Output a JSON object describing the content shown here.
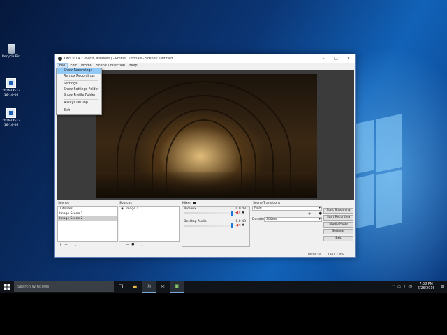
{
  "desktop": {
    "icons": [
      {
        "label": "Recycle Bin",
        "icon": "recycle-bin-icon"
      },
      {
        "label": "2016-06-17\n16-14-06",
        "icon": "image-file-icon"
      },
      {
        "label": "2016-06-17\n16-14-06",
        "icon": "image-file-icon"
      }
    ]
  },
  "obs": {
    "title": "OBS 0.14.2 (64bit, windows) - Profile: Tutorials - Scenes: Untitled",
    "menu": [
      "File",
      "Edit",
      "Profile",
      "Scene Collection",
      "Help"
    ],
    "active_menu": "File",
    "file_menu": {
      "items": [
        "Show Recordings",
        "Remux Recordings",
        "Settings",
        "Show Settings Folder",
        "Show Profile Folder",
        "Always On Top",
        "Exit"
      ],
      "highlighted": "Show Recordings"
    },
    "scenes": {
      "title": "Scenes",
      "items": [
        "Tutorials",
        "Image Scene 1",
        "Image Scene 2"
      ],
      "selected": "Image Scene 2"
    },
    "sources": {
      "title": "Sources",
      "items": [
        "Image 1"
      ]
    },
    "mixer": {
      "title": "Mixer",
      "channels": [
        {
          "name": "Mic/Aux",
          "db": "0.0 dB"
        },
        {
          "name": "Desktop Audio",
          "db": "0.0 dB"
        }
      ]
    },
    "transitions": {
      "title": "Scene Transitions",
      "selected": "Fade",
      "duration_label": "Duration",
      "duration_value": "300ms"
    },
    "controls": [
      "Start Streaming",
      "Start Recording",
      "Studio Mode",
      "Settings",
      "Exit"
    ],
    "status": {
      "time": "00:00:00",
      "cpu": "CPU: 1.4%"
    }
  },
  "taskbar": {
    "search_placeholder": "Search Windows",
    "time": "7:58 PM",
    "date": "6/26/2016"
  },
  "colors": {
    "accent": "#1e78d7",
    "taskbar": "#101419",
    "menu_highlight": "#91c9f7"
  }
}
